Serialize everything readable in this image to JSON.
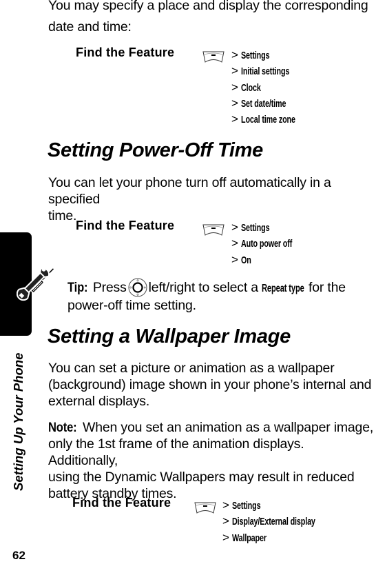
{
  "page": {
    "number": "62",
    "side_tab_label": "Setting Up Your Phone"
  },
  "sections": [
    {
      "intro": [
        "You may specify a place and display the corresponding",
        "date and time:"
      ],
      "find_feature": {
        "label": "Find the Feature",
        "icon": "menu-key-icon",
        "steps": [
          "Settings",
          "Initial settings",
          "Clock",
          "Set date/time",
          "Local time zone"
        ]
      }
    },
    {
      "heading": "Setting Power-Off Time",
      "body": [
        "You can let your phone turn off automatically in a specified",
        "time."
      ],
      "find_feature": {
        "label": "Find the Feature",
        "icon": "menu-key-icon",
        "steps": [
          "Settings",
          "Auto power off",
          "On"
        ]
      },
      "tip": {
        "label": "Tip:",
        "text_before": "Press",
        "icon": "navigation-key-icon",
        "text_middle": "left/right to select a",
        "emphasis": "Repeat type",
        "text_after": "for the",
        "line2": "power-off time setting."
      }
    },
    {
      "heading": "Setting a Wallpaper Image",
      "body": [
        "You can set a picture or animation as a wallpaper",
        "(background) image shown in your phone’s internal and",
        "external displays."
      ],
      "note": {
        "label": "Note:",
        "lines": [
          "When you set an animation as a wallpaper image,",
          "only the 1st frame of the animation displays. Additionally,",
          "using the Dynamic Wallpapers may result in reduced",
          "battery standby times."
        ]
      },
      "find_feature": {
        "label": "Find the Feature",
        "icon": "menu-key-icon",
        "steps": [
          "Settings",
          "Display/External display",
          "Wallpaper"
        ]
      }
    }
  ],
  "glyphs": {
    "step_prefix": ">"
  }
}
